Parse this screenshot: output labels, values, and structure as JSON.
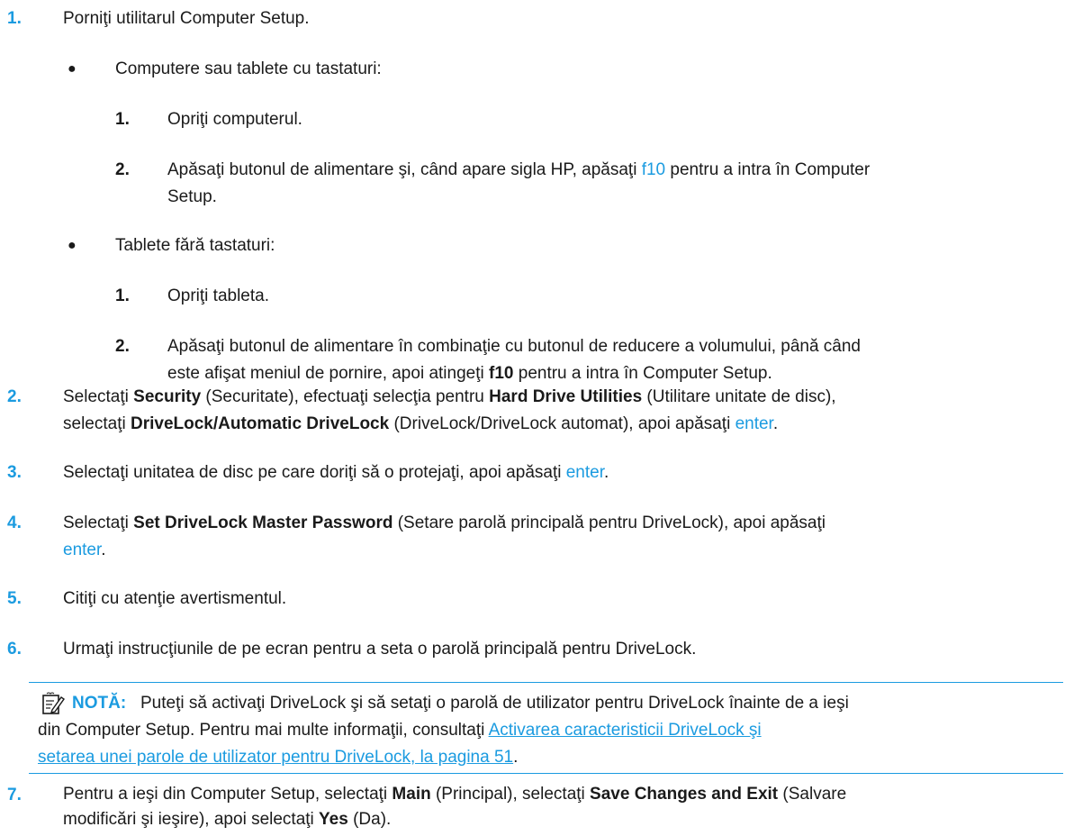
{
  "step1": {
    "num": "1.",
    "text": "Porniţi utilitarul Computer Setup.",
    "bullet1": {
      "label": "Computere sau tablete cu tastaturi:",
      "sub1": {
        "num": "1.",
        "text": "Opriţi computerul."
      },
      "sub2": {
        "num": "2.",
        "a": "Apăsaţi butonul de alimentare şi, când apare sigla HP, apăsaţi ",
        "key": "f10",
        "b": " pentru a intra în Computer",
        "line2": "Setup."
      }
    },
    "bullet2": {
      "label": "Tablete fără tastaturi:",
      "sub1": {
        "num": "1.",
        "text": "Opriţi tableta."
      },
      "sub2": {
        "num": "2.",
        "line1": "Apăsaţi butonul de alimentare în combinaţie cu butonul de reducere a volumului, până când",
        "a": "este afişat meniul de pornire, apoi atingeţi ",
        "key": "f10",
        "b": " pentru a intra în Computer Setup."
      }
    }
  },
  "step2": {
    "num": "2.",
    "t1": "Selectaţi ",
    "b1": "Security",
    "t2": " (Securitate), efectuaţi selecţia pentru ",
    "b2": "Hard Drive Utilities",
    "t3": " (Utilitare unitate de disc),",
    "t4": "selectaţi ",
    "b3": "DriveLock/Automatic DriveLock",
    "t5": " (DriveLock/DriveLock automat), apoi apăsaţi ",
    "key": "enter",
    "t6": "."
  },
  "step3": {
    "num": "3.",
    "t1": "Selectaţi unitatea de disc pe care doriţi să o protejaţi, apoi apăsaţi ",
    "key": "enter",
    "t2": "."
  },
  "step4": {
    "num": "4.",
    "t1": "Selectaţi ",
    "b1": "Set DriveLock Master Password",
    "t2": " (Setare parolă principală pentru DriveLock), apoi apăsaţi",
    "key": "enter",
    "t3": "."
  },
  "step5": {
    "num": "5.",
    "text": "Citiţi cu atenţie avertismentul."
  },
  "step6": {
    "num": "6.",
    "text": "Urmaţi instrucţiunile de pe ecran pentru a seta o parolă principală pentru DriveLock."
  },
  "note": {
    "icon": "note-pencil-icon",
    "label": "NOTĂ:",
    "t1": "Puteţi să activaţi DriveLock şi să setaţi o parolă de utilizator pentru DriveLock înainte de a ieşi",
    "t2": "din Computer Setup. Pentru mai multe informaţii, consultaţi ",
    "link1": "Activarea caracteristicii DriveLock şi",
    "link2": "setarea unei parole de utilizator pentru DriveLock, la pagina 51",
    "t3": "."
  },
  "step7": {
    "num": "7.",
    "t1": "Pentru a ieşi din Computer Setup, selectaţi ",
    "b1": "Main",
    "t2": " (Principal), selectaţi ",
    "b2": "Save Changes and Exit",
    "t3": " (Salvare",
    "t4": "modificări şi ieşire), apoi selectaţi ",
    "b3": "Yes",
    "t5": " (Da)."
  },
  "colors": {
    "accent": "#1b9be0",
    "text": "#1a1a1a"
  }
}
